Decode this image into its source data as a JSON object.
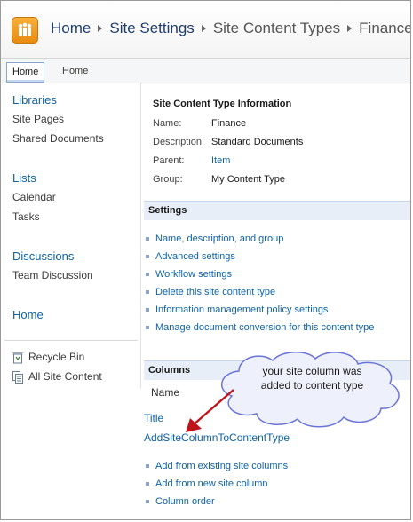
{
  "breadcrumb": {
    "items": [
      "Home",
      "Site Settings",
      "Site Content Types",
      "Finance"
    ]
  },
  "top_nav": {
    "tabs": [
      {
        "label": "Home",
        "active": true
      },
      {
        "label": "Home",
        "active": false
      }
    ]
  },
  "quick_launch": {
    "libraries": {
      "heading": "Libraries",
      "items": [
        "Site Pages",
        "Shared Documents"
      ]
    },
    "lists": {
      "heading": "Lists",
      "items": [
        "Calendar",
        "Tasks"
      ]
    },
    "discussions": {
      "heading": "Discussions",
      "items": [
        "Team Discussion"
      ]
    },
    "home": {
      "heading": "Home"
    },
    "footer": {
      "recycle_bin": "Recycle Bin",
      "all_site_content": "All Site Content"
    }
  },
  "info": {
    "title": "Site Content Type Information",
    "rows": [
      {
        "label": "Name:",
        "value": "Finance"
      },
      {
        "label": "Description:",
        "value": "Standard Documents"
      },
      {
        "label": "Parent:",
        "value": "Item"
      },
      {
        "label": "Group:",
        "value": "My Content Type"
      }
    ]
  },
  "settings": {
    "heading": "Settings",
    "links": [
      "Name, description, and group",
      "Advanced settings",
      "Workflow settings",
      "Delete this site content type",
      "Information management policy settings",
      "Manage document conversion for this content type"
    ]
  },
  "columns": {
    "heading": "Columns",
    "header_name": "Name",
    "items": [
      "Title",
      "AddSiteColumnToContentType"
    ],
    "actions": [
      "Add from existing site columns",
      "Add from new site column",
      "Column order"
    ]
  },
  "callout": {
    "line1": "your site column was",
    "line2": "added to content type"
  },
  "colors": {
    "link": "#0e62a5",
    "section_bg": "#e8eef7",
    "logo": "#f0a020",
    "arrow": "#c0141c"
  }
}
